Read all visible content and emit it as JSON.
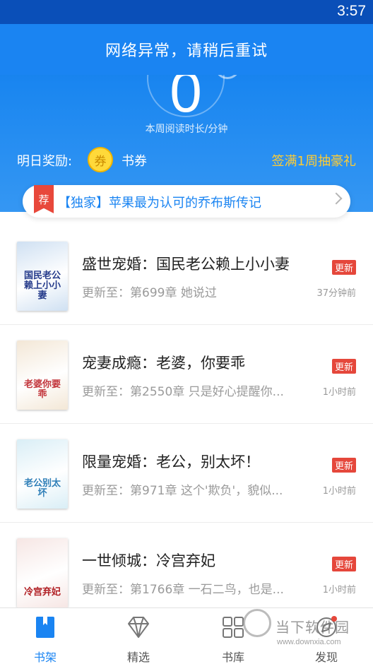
{
  "status_bar": {
    "time": "3:57"
  },
  "error_banner": "网络异常，请稍后重试",
  "reading_stats": {
    "minutes_value": "0",
    "label": "本周阅读时长/分钟"
  },
  "reward": {
    "label": "明日奖励:",
    "coin_char": "券",
    "coupon_label": "书券",
    "lottery_link": "签满1周抽豪礼"
  },
  "recommend": {
    "tag": "荐",
    "text": "【独家】苹果最为认可的乔布斯传记"
  },
  "books": [
    {
      "title": "盛世宠婚：国民老公赖上小小妻",
      "update": "更新至：第699章 她说过",
      "badge": "更新",
      "time": "37分钟前",
      "cover_text": "国民老公赖上小小妻",
      "cover_bg": "#cfe0f2",
      "cover_fg": "#243a8a"
    },
    {
      "title": "宠妻成瘾：老婆，你要乖",
      "update": "更新至：第2550章 只是好心提醒你...",
      "badge": "更新",
      "time": "1小时前",
      "cover_text": "老婆你要乖",
      "cover_bg": "#f3e7d6",
      "cover_fg": "#c2343a"
    },
    {
      "title": "限量宠婚：老公，别太坏！",
      "update": "更新至：第971章 这个'欺负'，貌似...",
      "badge": "更新",
      "time": "1小时前",
      "cover_text": "老公别太坏",
      "cover_bg": "#d9eef6",
      "cover_fg": "#2f7fb8"
    },
    {
      "title": "一世倾城：冷宫弃妃",
      "update": "更新至：第1766章 一石二鸟，也是...",
      "badge": "更新",
      "time": "1小时前",
      "cover_text": "冷宫弃妃",
      "cover_bg": "#f6e6e4",
      "cover_fg": "#b01e23"
    }
  ],
  "bottom_nav": [
    {
      "label": "书架",
      "icon": "bookshelf-icon",
      "active": true
    },
    {
      "label": "精选",
      "icon": "diamond-icon",
      "active": false
    },
    {
      "label": "书库",
      "icon": "grid-icon",
      "active": false
    },
    {
      "label": "发现",
      "icon": "discover-icon",
      "active": false
    }
  ],
  "watermark": {
    "text": "当下软件园",
    "url": "www.downxia.com"
  },
  "colors": {
    "primary_blue": "#1a84f2",
    "badge_red": "#e5473b",
    "gold": "#ffcc33"
  }
}
